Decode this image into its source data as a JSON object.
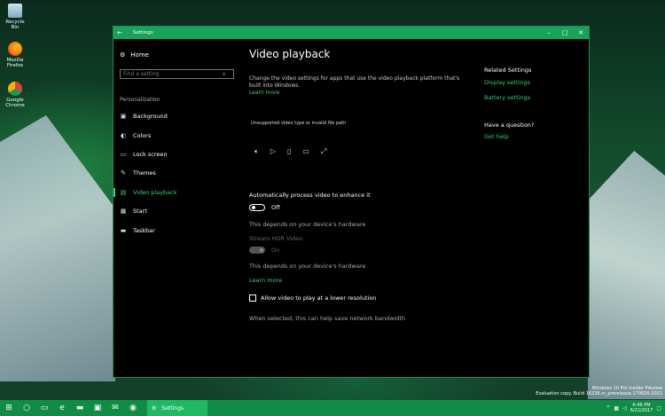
{
  "desktop": {
    "icons": [
      {
        "label": "Recycle Bin",
        "icon": "recycle-bin-icon"
      },
      {
        "label": "Mozilla Firefox",
        "icon": "firefox-icon"
      },
      {
        "label": "Google Chrome",
        "icon": "chrome-icon"
      }
    ],
    "watermark_line1": "Windows 10 Pro Insider Preview",
    "watermark_line2": "Evaluation copy. Build 16226.rs_prerelease.170616-2021"
  },
  "window": {
    "title": "Settings",
    "accent": "#17a45a",
    "sidebar": {
      "home_label": "Home",
      "search_placeholder": "Find a setting",
      "section_label": "Personalization",
      "items": [
        {
          "label": "Background",
          "icon": "picture-icon"
        },
        {
          "label": "Colors",
          "icon": "palette-icon"
        },
        {
          "label": "Lock screen",
          "icon": "lock-screen-icon"
        },
        {
          "label": "Themes",
          "icon": "brush-icon"
        },
        {
          "label": "Video playback",
          "icon": "video-icon",
          "active": true
        },
        {
          "label": "Start",
          "icon": "start-icon"
        },
        {
          "label": "Taskbar",
          "icon": "taskbar-icon"
        }
      ]
    },
    "main": {
      "page_title": "Video playback",
      "description": "Change the video settings for apps that use the video playback platform that's built into Windows.",
      "learn_more_1": "Learn more",
      "video_message": "Unsupported video type or invalid file path",
      "auto_process_title": "Automatically process video to enhance it",
      "auto_process_state": "Off",
      "hardware_note_1": "This depends on your device's hardware",
      "hdr_title": "Stream HDR Video",
      "hdr_state": "On",
      "hardware_note_2": "This depends on your device's hardware",
      "learn_more_2": "Learn more",
      "low_res_label": "Allow video to play at a lower resolution",
      "low_res_note": "When selected, this can help save network bandwidth"
    },
    "related": {
      "heading": "Related Settings",
      "display_link": "Display settings",
      "battery_link": "Battery settings",
      "question_heading": "Have a question?",
      "help_link": "Get help"
    }
  },
  "taskbar": {
    "settings_label": "Settings",
    "time": "6:46 PM",
    "date": "6/22/2017"
  }
}
